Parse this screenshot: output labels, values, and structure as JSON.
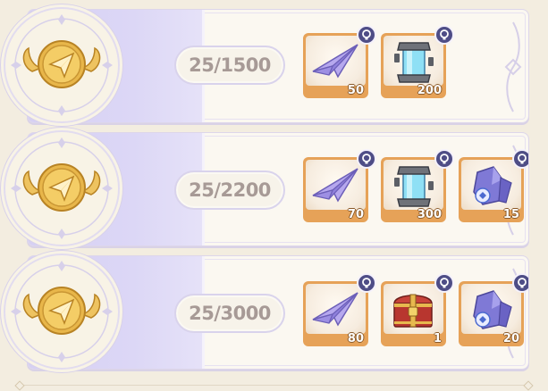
{
  "tiers": [
    {
      "progress": "25/1500",
      "rewards": [
        {
          "item": "paper-plane-icon",
          "qty": "50"
        },
        {
          "item": "capsule-canister-icon",
          "qty": "200"
        }
      ]
    },
    {
      "progress": "25/2200",
      "rewards": [
        {
          "item": "paper-plane-icon",
          "qty": "70"
        },
        {
          "item": "capsule-canister-icon",
          "qty": "300"
        },
        {
          "item": "crystal-shard-icon",
          "qty": "15"
        }
      ]
    },
    {
      "progress": "25/3000",
      "rewards": [
        {
          "item": "paper-plane-icon",
          "qty": "80"
        },
        {
          "item": "treasure-chest-icon",
          "qty": "1"
        },
        {
          "item": "crystal-shard-icon",
          "qty": "20"
        }
      ]
    }
  ],
  "colors": {
    "band": "#d8d2f4",
    "item_frame": "#e6a258",
    "progress_text": "#a79a96",
    "hint_badge": "#4e4d86",
    "medal_gold": "#e8b64a"
  }
}
